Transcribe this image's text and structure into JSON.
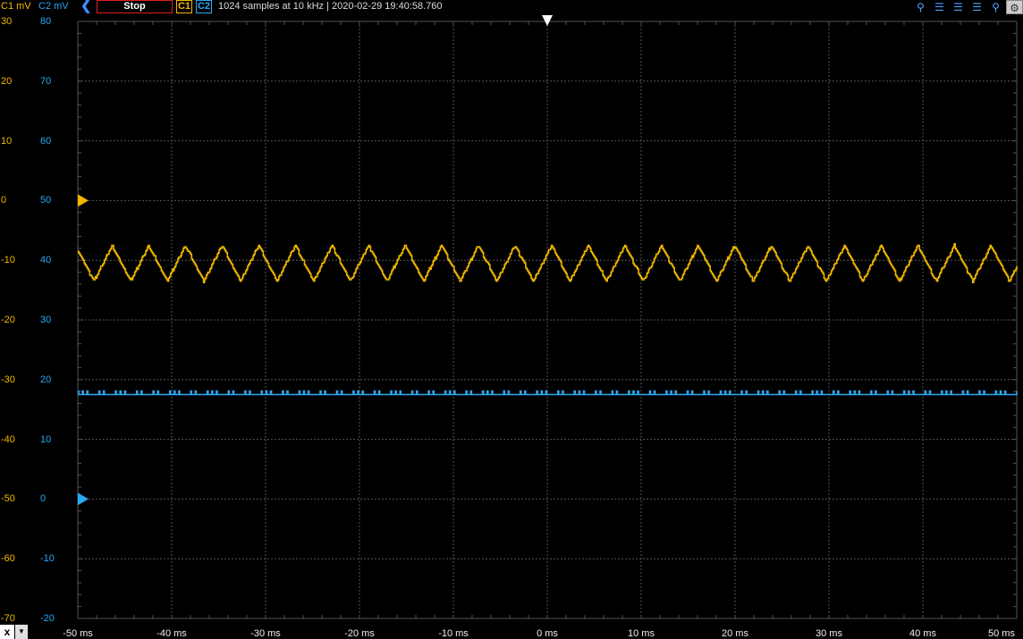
{
  "toolbar": {
    "c1_unit_label": "C1 mV",
    "c2_unit_label": "C2 mV",
    "back_icon": "chevron-left-icon",
    "stop_label": "Stop",
    "c1_button": "C1",
    "c2_button": "C2",
    "info": "1024 samples at 10 kHz | 2020-02-29 19:40:58.760",
    "tools": [
      "zoom-icon",
      "cursor-left-icon",
      "cursor-center-icon",
      "cursor-right-icon",
      "zoom-out-icon",
      "gear-icon"
    ]
  },
  "axes": {
    "y1_ticks": [
      "30",
      "20",
      "10",
      "0",
      "-10",
      "-20",
      "-30",
      "-40",
      "-50",
      "-60",
      "-70"
    ],
    "y2_ticks": [
      "80",
      "70",
      "60",
      "50",
      "40",
      "30",
      "20",
      "10",
      "0",
      "-10",
      "-20"
    ],
    "x_ticks": [
      "-50 ms",
      "-40 ms",
      "-30 ms",
      "-20 ms",
      "-10 ms",
      "0 ms",
      "10 ms",
      "20 ms",
      "30 ms",
      "40 ms",
      "50 ms"
    ],
    "x_button": "x"
  },
  "colors": {
    "c1": "#f0b800",
    "c2": "#2aa8f2",
    "grid": "#555555"
  },
  "chart_data": {
    "type": "line",
    "x_range_ms": [
      -50,
      50
    ],
    "y1_range_mV": [
      -70,
      30
    ],
    "y2_range_mV": [
      -20,
      80
    ],
    "grid": true,
    "series": [
      {
        "name": "C1",
        "axis": "y1",
        "unit": "mV",
        "waveform": "triangle-like",
        "min": -13.5,
        "max": -7.5,
        "period_ms": 3.9,
        "offset_marker": 0
      },
      {
        "name": "C2",
        "axis": "y2",
        "unit": "mV",
        "waveform": "flat with 1-LSB noise",
        "value": 17.5,
        "offset_marker": 0
      }
    ]
  }
}
